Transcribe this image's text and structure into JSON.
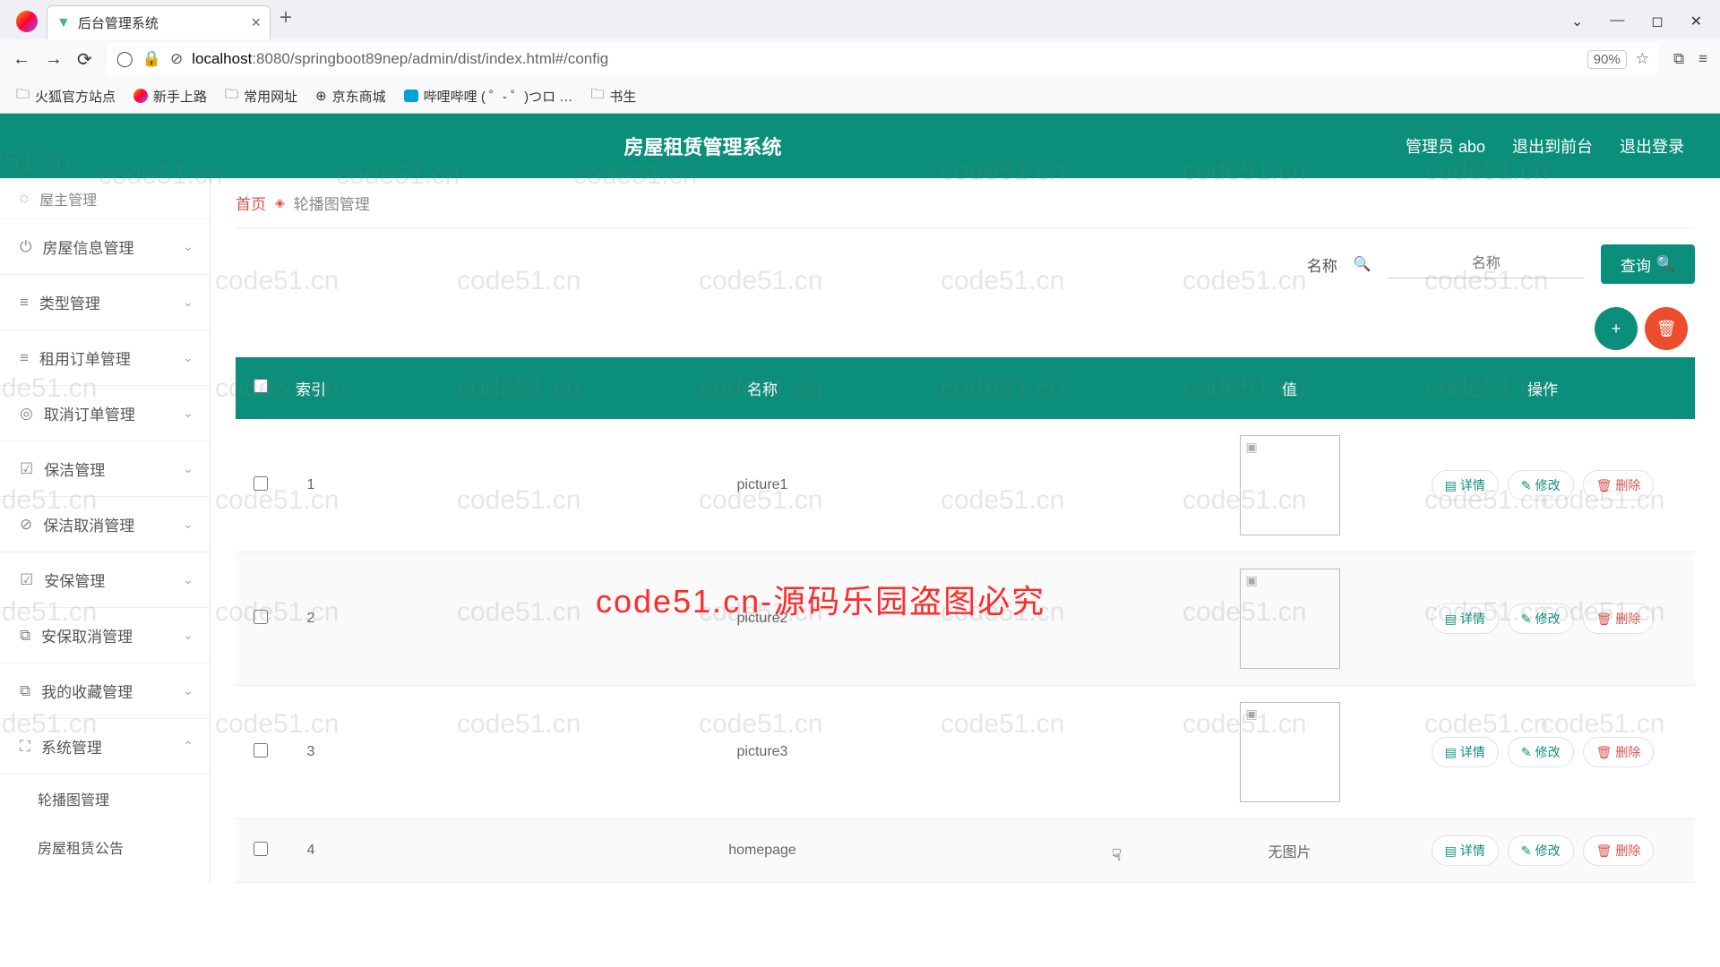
{
  "browser": {
    "tab_title": "后台管理系统",
    "url_prefix": "localhost",
    "url_rest": ":8080/springboot89nep/admin/dist/index.html#/config",
    "zoom": "90%"
  },
  "bookmarks": [
    "火狐官方站点",
    "新手上路",
    "常用网址",
    "京东商城",
    "哔哩哔哩 (  ゜- ゜)つロ …",
    "书生"
  ],
  "header": {
    "title": "房屋租赁管理系统",
    "admin": "管理员 abo",
    "to_front": "退出到前台",
    "logout": "退出登录"
  },
  "sidebar": {
    "top": "屋主管理",
    "items": [
      "房屋信息管理",
      "类型管理",
      "租用订单管理",
      "取消订单管理",
      "保洁管理",
      "保洁取消管理",
      "安保管理",
      "安保取消管理",
      "我的收藏管理",
      "系统管理"
    ],
    "subs": [
      "轮播图管理",
      "房屋租赁公告"
    ]
  },
  "breadcrumb": {
    "home": "首页",
    "cur": "轮播图管理"
  },
  "search": {
    "label": "名称",
    "placeholder": "名称",
    "btn": "查询"
  },
  "table": {
    "headers": {
      "idx": "索引",
      "name": "名称",
      "value": "值",
      "ops": "操作"
    },
    "rows": [
      {
        "idx": "1",
        "name": "picture1",
        "value": "img"
      },
      {
        "idx": "2",
        "name": "picture2",
        "value": "img"
      },
      {
        "idx": "3",
        "name": "picture3",
        "value": "img"
      },
      {
        "idx": "4",
        "name": "homepage",
        "value": "无图片"
      }
    ],
    "ops": {
      "detail": "详情",
      "edit": "修改",
      "del": "删除"
    }
  },
  "overlay": "code51.cn-源码乐园盗图必究",
  "watermark": "code51.cn"
}
